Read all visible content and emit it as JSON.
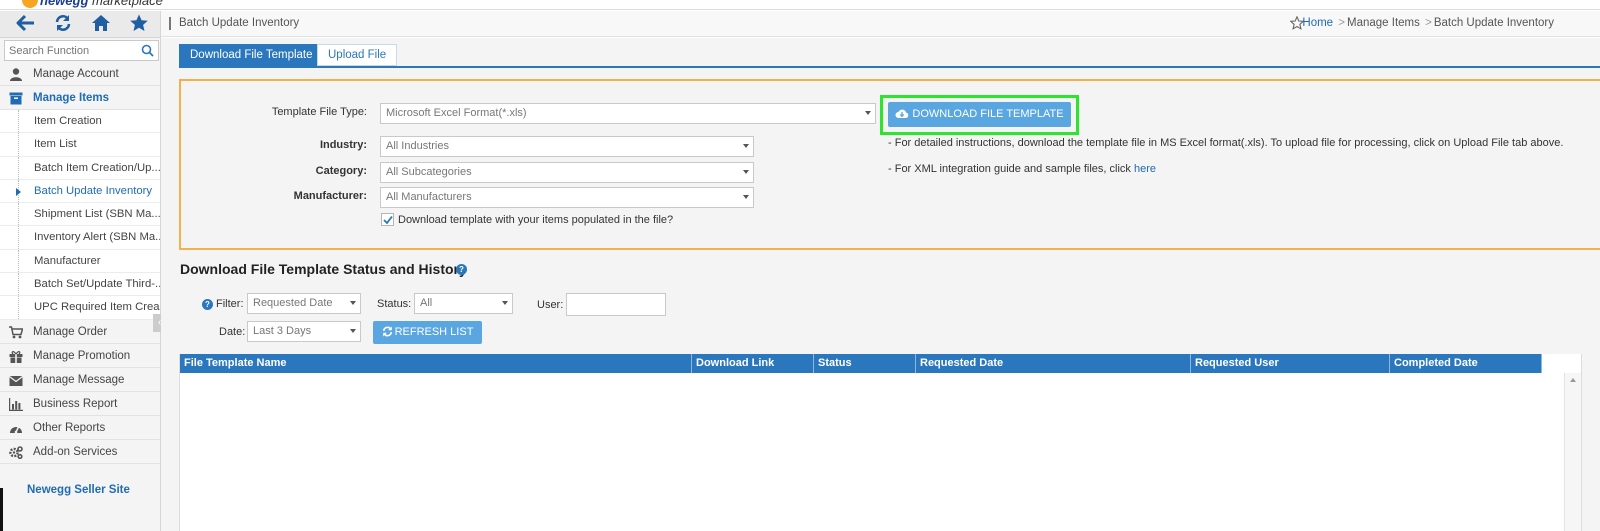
{
  "brand": {
    "logo_text": "newegg",
    "logo_suffix": "marketplace",
    "accent": "#2b77bd",
    "highlight": "#2ee52e"
  },
  "toolbar": {
    "icons": [
      "back-arrow-icon",
      "refresh-icon",
      "home-icon",
      "star-icon"
    ]
  },
  "sidebar": {
    "search_placeholder": "Search Function",
    "items": [
      {
        "label": "Manage Account",
        "icon": "user-icon"
      },
      {
        "label": "Manage Items",
        "icon": "box-icon",
        "active": true
      },
      {
        "label": "Manage Order",
        "icon": "cart-icon"
      },
      {
        "label": "Manage Promotion",
        "icon": "gift-icon"
      },
      {
        "label": "Manage Message",
        "icon": "envelope-icon"
      },
      {
        "label": "Business Report",
        "icon": "bar-chart-icon"
      },
      {
        "label": "Other Reports",
        "icon": "dashboard-icon"
      },
      {
        "label": "Add-on Services",
        "icon": "gears-icon"
      }
    ],
    "subitems": [
      "Item Creation",
      "Item List",
      "Batch Item Creation/Up...",
      "Batch Update Inventory",
      "Shipment List (SBN Ma...",
      "Inventory Alert (SBN Ma...",
      "Manufacturer",
      "Batch Set/Update Third-...",
      "UPC Required Item Crea..."
    ],
    "seller_site": "Newegg Seller Site"
  },
  "header": {
    "title": "Batch Update Inventory",
    "breadcrumb": {
      "home": "Home",
      "level1": "Manage Items",
      "level2": "Batch Update Inventory",
      "sep": ">"
    }
  },
  "tabs": {
    "download": "Download File Template",
    "upload": "Upload File"
  },
  "form": {
    "template_type_label": "Template File Type:",
    "template_type_value": "Microsoft Excel Format(*.xls)",
    "industry_label": "Industry:",
    "industry_value": "All Industries",
    "category_label": "Category:",
    "category_value": "All Subcategories",
    "manufacturer_label": "Manufacturer:",
    "manufacturer_value": "All Manufacturers",
    "populate_checkbox_label": "Download template with your items populated in the file?",
    "populate_checked": true,
    "download_button": "DOWNLOAD FILE TEMPLATE",
    "note1": "- For detailed instructions, download the template file in MS Excel format(.xls). To upload file for processing, click on Upload File tab above.",
    "note2_prefix": "- For XML integration guide and sample files, click ",
    "note2_link": "here"
  },
  "history": {
    "title": "Download File Template Status and History",
    "filter_label": "Filter:",
    "filter_value": "Requested Date",
    "status_label": "Status:",
    "status_value": "All",
    "user_label": "User:",
    "user_value": "",
    "date_label": "Date:",
    "date_value": "Last 3 Days",
    "refresh_button": "REFRESH LIST",
    "columns": [
      "File Template Name",
      "Download Link",
      "Status",
      "Requested Date",
      "Requested User",
      "Completed Date"
    ],
    "rows": []
  }
}
